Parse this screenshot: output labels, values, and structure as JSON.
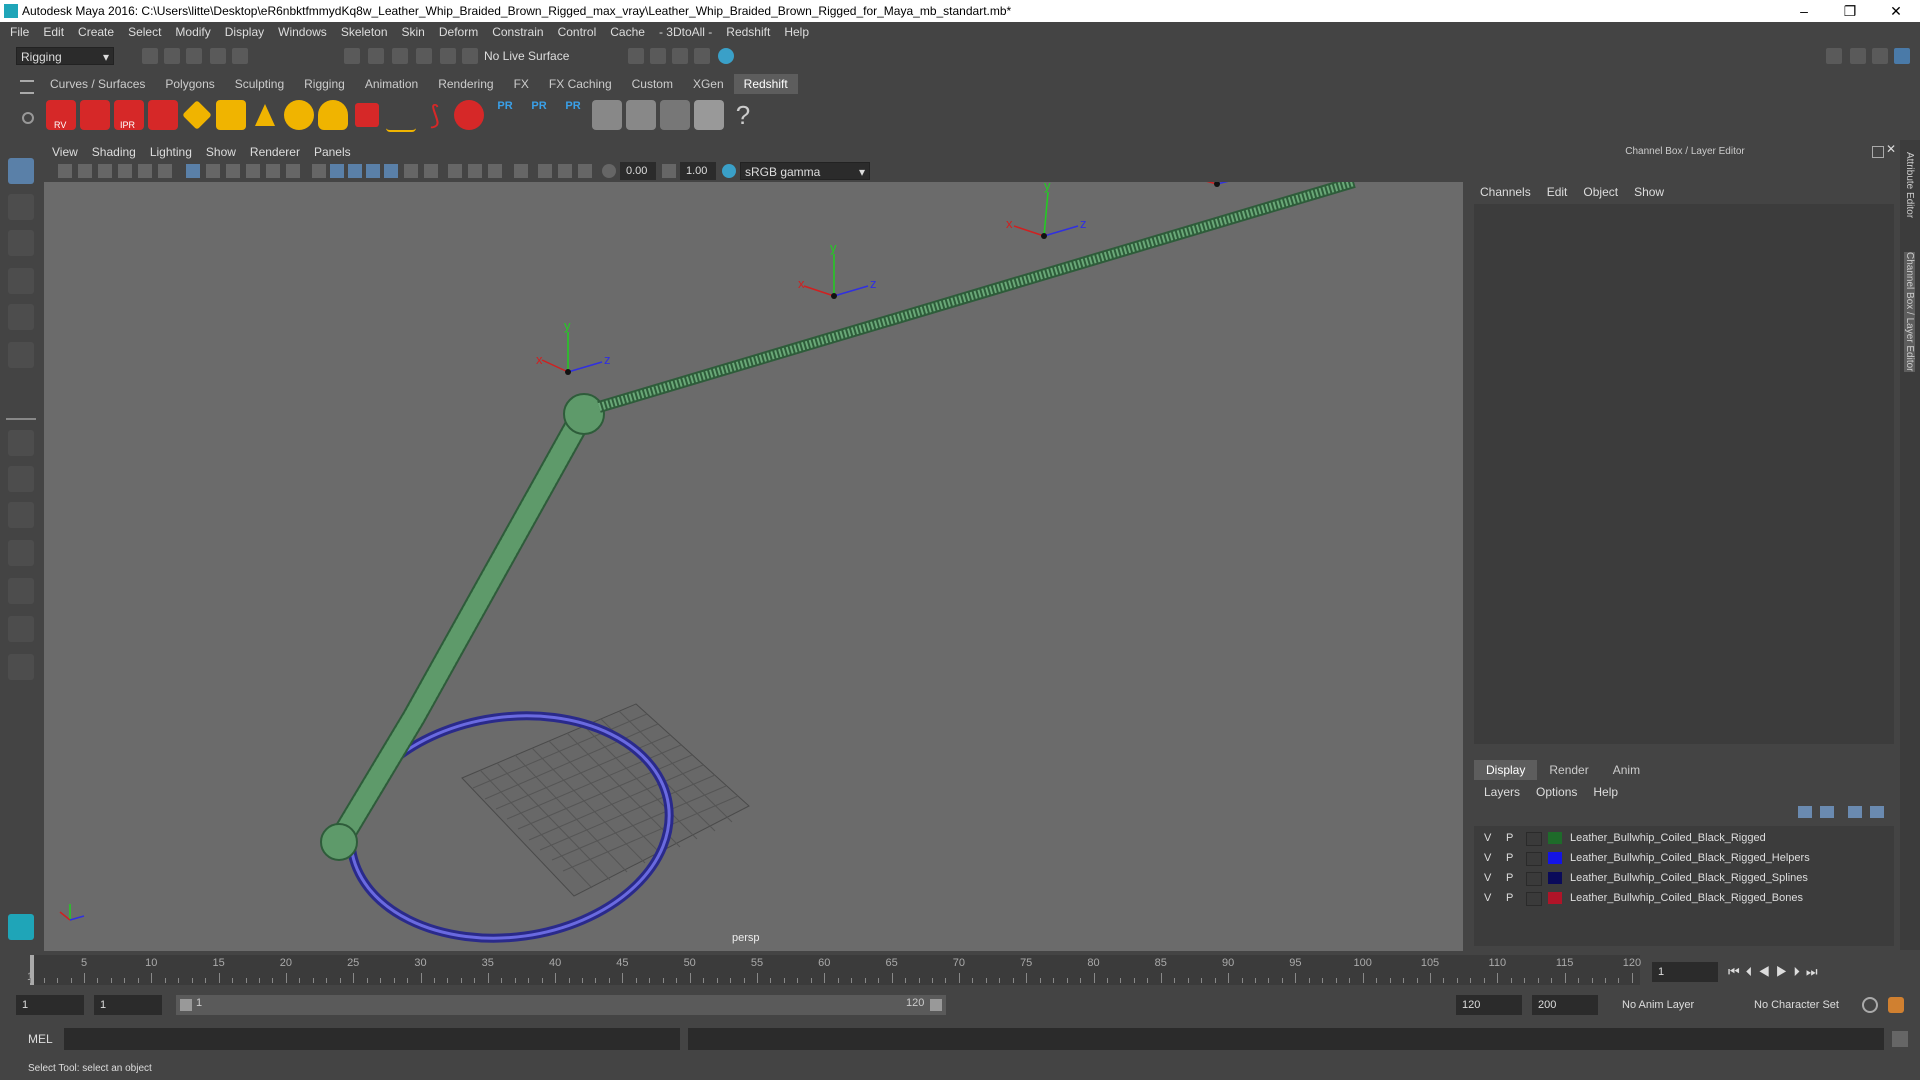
{
  "window": {
    "title": "Autodesk Maya 2016: C:\\Users\\litte\\Desktop\\eR6nbktfmmydKq8w_Leather_Whip_Braided_Brown_Rigged_max_vray\\Leather_Whip_Braided_Brown_Rigged_for_Maya_mb_standart.mb*",
    "minimize": "–",
    "maximize": "❐",
    "close": "✕"
  },
  "menubar": [
    "File",
    "Edit",
    "Create",
    "Select",
    "Modify",
    "Display",
    "Windows",
    "Skeleton",
    "Skin",
    "Deform",
    "Constrain",
    "Control",
    "Cache",
    "- 3DtoAll -",
    "Redshift",
    "Help"
  ],
  "statusline": {
    "mode": "Rigging",
    "live_surface": "No Live Surface"
  },
  "shelf": {
    "tabs": [
      "Curves / Surfaces",
      "Polygons",
      "Sculpting",
      "Rigging",
      "Animation",
      "Rendering",
      "FX",
      "FX Caching",
      "Custom",
      "XGen",
      "Redshift"
    ],
    "active_tab": "Redshift",
    "icon_labels": [
      "RV",
      "IPR",
      "PR",
      "PR",
      "PR"
    ]
  },
  "viewport": {
    "menu": [
      "View",
      "Shading",
      "Lighting",
      "Show",
      "Renderer",
      "Panels"
    ],
    "exposure": "0.00",
    "gamma": "1.00",
    "color_space": "sRGB gamma",
    "camera_label": "persp",
    "axis_labels": {
      "x": "x",
      "y": "y",
      "z": "z"
    }
  },
  "channel_box": {
    "title": "Channel Box / Layer Editor",
    "menu": [
      "Channels",
      "Edit",
      "Object",
      "Show"
    ],
    "side_tabs": [
      "Attribute Editor",
      "Channel Box / Layer Editor"
    ]
  },
  "layer_editor": {
    "tabs": [
      "Display",
      "Render",
      "Anim"
    ],
    "active_tab": "Display",
    "menu": [
      "Layers",
      "Options",
      "Help"
    ],
    "layers": [
      {
        "v": "V",
        "p": "P",
        "color": "#1e6b2a",
        "name": "Leather_Bullwhip_Coiled_Black_Rigged"
      },
      {
        "v": "V",
        "p": "P",
        "color": "#1414e6",
        "name": "Leather_Bullwhip_Coiled_Black_Rigged_Helpers"
      },
      {
        "v": "V",
        "p": "P",
        "color": "#0a0a5a",
        "name": "Leather_Bullwhip_Coiled_Black_Rigged_Splines"
      },
      {
        "v": "V",
        "p": "P",
        "color": "#b01428",
        "name": "Leather_Bullwhip_Coiled_Black_Rigged_Bones"
      }
    ]
  },
  "timeline": {
    "ticks": [
      "5",
      "10",
      "15",
      "20",
      "25",
      "30",
      "35",
      "40",
      "45",
      "50",
      "55",
      "60",
      "65",
      "70",
      "75",
      "80",
      "85",
      "90",
      "95",
      "100",
      "105",
      "110",
      "115",
      "120"
    ],
    "first_frame": "1",
    "current_frame": "1",
    "range_start": "1",
    "range_start_inner": "1",
    "range_slider_start": "1",
    "range_slider_end": "120",
    "range_end": "120",
    "anim_end": "200",
    "anim_layer": "No Anim Layer",
    "character_set": "No Character Set"
  },
  "command_line": {
    "label": "MEL"
  },
  "help_line": "Select Tool: select an object"
}
